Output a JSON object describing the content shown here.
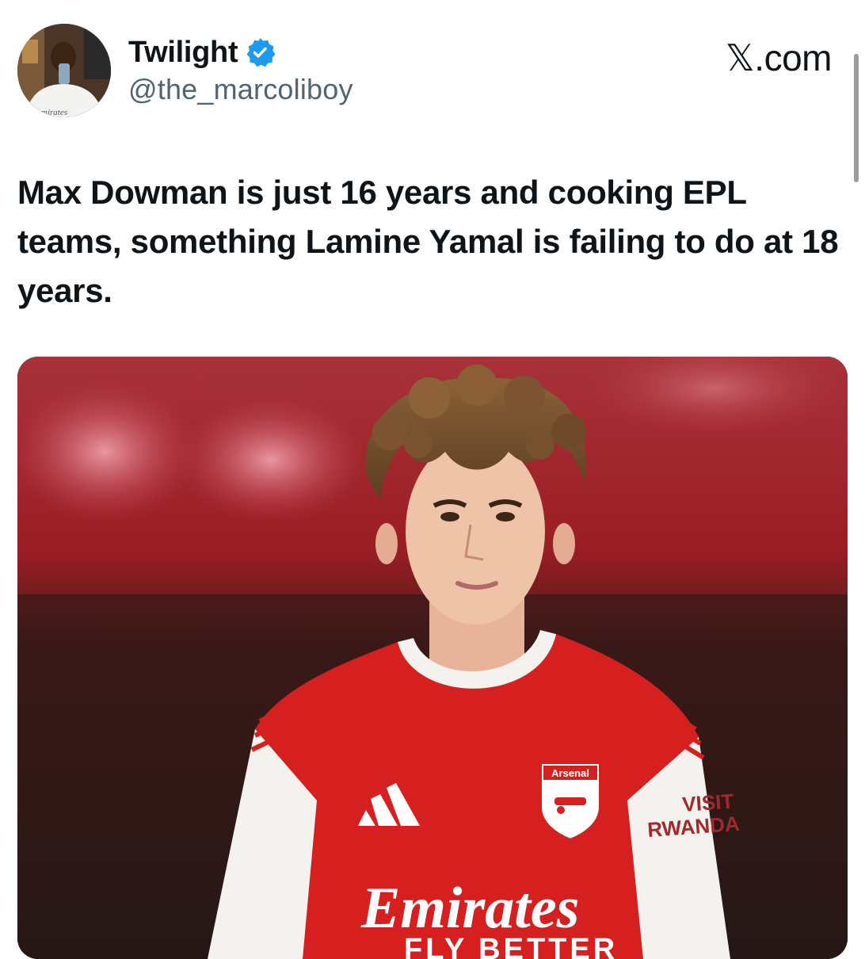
{
  "author": {
    "display_name": "Twilight",
    "handle": "@the_marcoliboy",
    "verified_icon": "verified-badge-icon",
    "avatar_caption": "mirates"
  },
  "brand": {
    "label": "𝕏.com"
  },
  "post": {
    "text": "Max Dowman is just 16 years and cooking EPL teams, something Lamine Yamal is failing to do at 18 years."
  },
  "media": {
    "shirt_sponsor": "Emirates",
    "shirt_sponsor_tagline": "FLY BETTER",
    "crest_text": "Arsenal",
    "sleeve_text_line1": "VISIT",
    "sleeve_text_line2": "RWANDA"
  },
  "colors": {
    "verified_blue": "#1d9bf0",
    "handle_gray": "#536471",
    "arsenal_red": "#d6201f"
  }
}
